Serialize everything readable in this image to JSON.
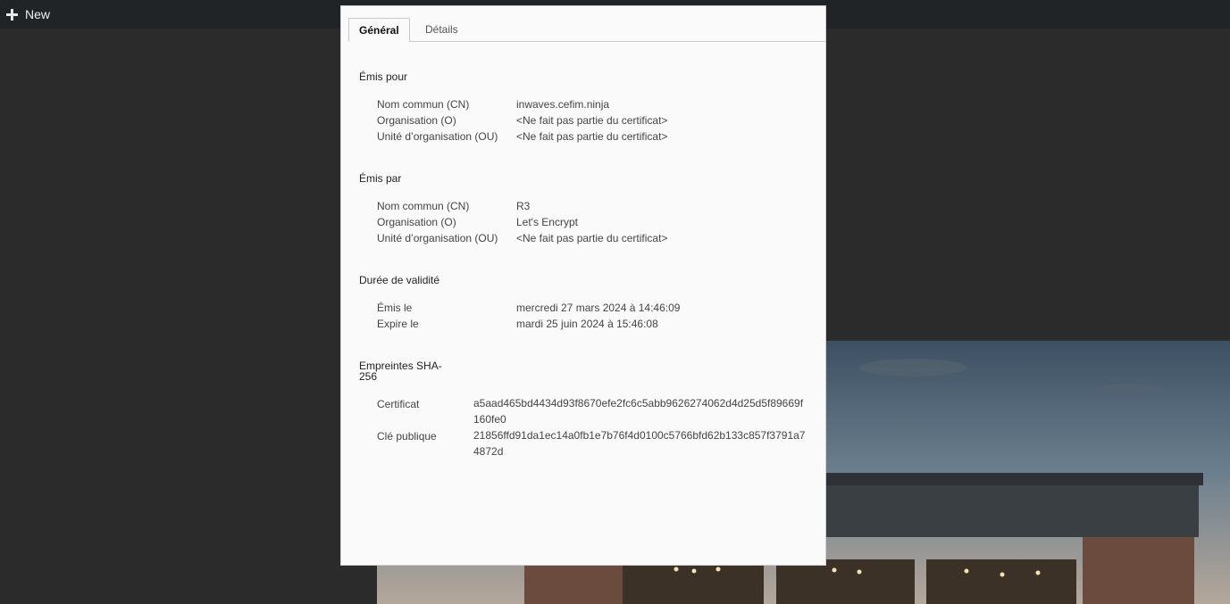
{
  "topbar": {
    "new_label": "New"
  },
  "dialog": {
    "tabs": [
      {
        "label": "Général",
        "active": true
      },
      {
        "label": "Détails",
        "active": false
      }
    ],
    "issued_to": {
      "title": "Émis pour",
      "rows": [
        {
          "label": "Nom commun (CN)",
          "value": "inwaves.cefim.ninja"
        },
        {
          "label": "Organisation (O)",
          "value": "<Ne fait pas partie du certificat>"
        },
        {
          "label": "Unité d’organisation (OU)",
          "value": "<Ne fait pas partie du certificat>"
        }
      ]
    },
    "issued_by": {
      "title": "Émis par",
      "rows": [
        {
          "label": "Nom commun (CN)",
          "value": "R3"
        },
        {
          "label": "Organisation (O)",
          "value": "Let's Encrypt"
        },
        {
          "label": "Unité d’organisation (OU)",
          "value": "<Ne fait pas partie du certificat>"
        }
      ]
    },
    "validity": {
      "title": "Durée de validité",
      "rows": [
        {
          "label": "Émis le",
          "value": "mercredi 27 mars 2024 à 14:46:09"
        },
        {
          "label": "Expire le",
          "value": "mardi 25 juin 2024 à 15:46:08"
        }
      ]
    },
    "fingerprints": {
      "title_line1": "Empreintes SHA-",
      "title_line2": "256",
      "rows": [
        {
          "label": "Certificat",
          "value": "a5aad465bd4434d93f8670efe2fc6c5abb9626274062d4d25d5f89669f160fe0"
        },
        {
          "label": "Clé publique",
          "value": "21856ffd91da1ec14a0fb1e7b76f4d0100c5766bfd62b133c857f3791a74872d"
        }
      ]
    }
  }
}
